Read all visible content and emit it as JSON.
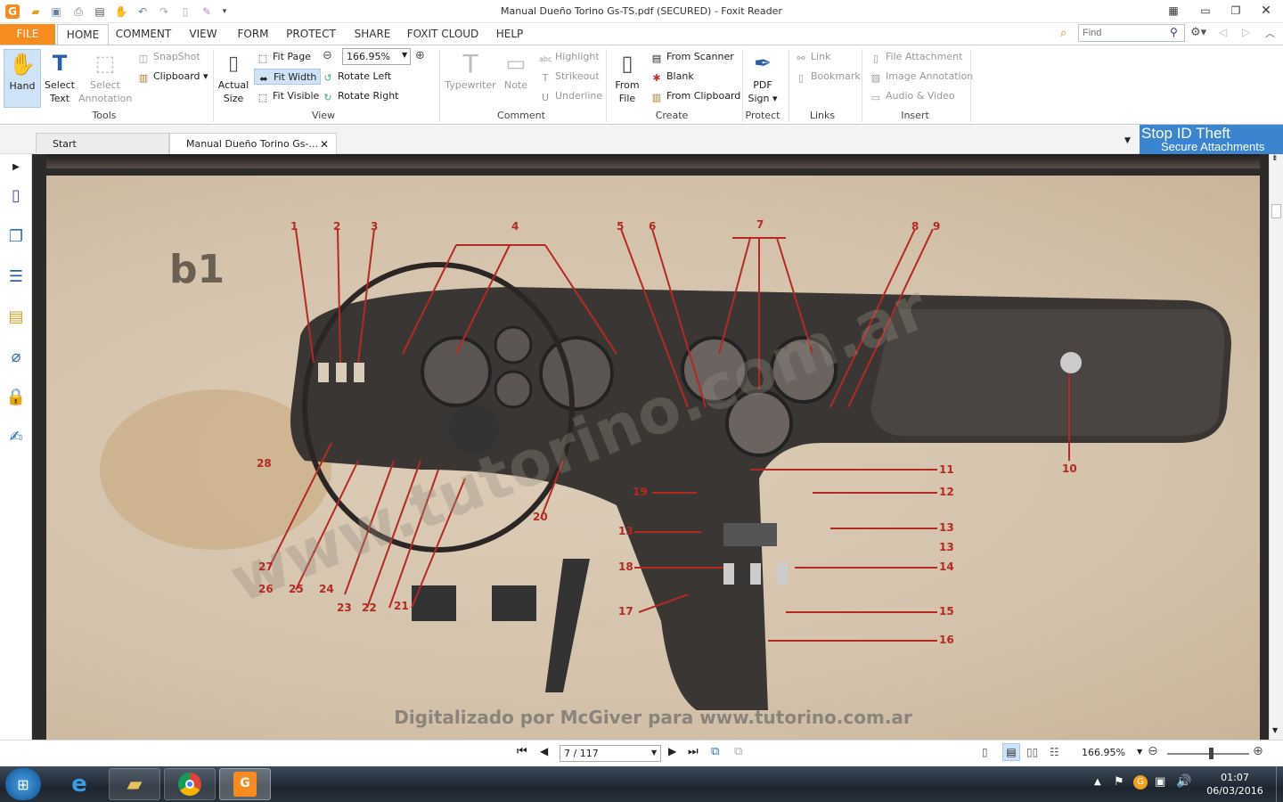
{
  "window": {
    "title": "Manual Dueño Torino Gs-TS.pdf (SECURED) - Foxit Reader"
  },
  "menu": {
    "file": "FILE",
    "tabs": [
      "HOME",
      "COMMENT",
      "VIEW",
      "FORM",
      "PROTECT",
      "SHARE",
      "FOXIT CLOUD",
      "HELP"
    ],
    "search_placeholder": "Find"
  },
  "ribbon": {
    "tools": {
      "hand": "Hand",
      "select_text_1": "Select",
      "select_text_2": "Text",
      "select_annotation_1": "Select",
      "select_annotation_2": "Annotation",
      "snapshot": "SnapShot",
      "clipboard": "Clipboard",
      "label": "Tools"
    },
    "view": {
      "actual_size_1": "Actual",
      "actual_size_2": "Size",
      "fit_page": "Fit Page",
      "fit_width": "Fit Width",
      "fit_visible": "Fit Visible",
      "zoom_value": "166.95%",
      "rotate_left": "Rotate Left",
      "rotate_right": "Rotate Right",
      "label": "View"
    },
    "comment": {
      "typewriter": "Typewriter",
      "note": "Note",
      "highlight": "Highlight",
      "strikeout": "Strikeout",
      "underline": "Underline",
      "label": "Comment"
    },
    "create": {
      "from_file_1": "From",
      "from_file_2": "File",
      "from_scanner": "From Scanner",
      "blank": "Blank",
      "from_clipboard": "From Clipboard",
      "label": "Create"
    },
    "protect": {
      "pdf_sign_1": "PDF",
      "pdf_sign_2": "Sign",
      "label": "Protect"
    },
    "links": {
      "link": "Link",
      "bookmark": "Bookmark",
      "label": "Links"
    },
    "insert": {
      "file_attachment": "File Attachment",
      "image_annotation": "Image Annotation",
      "audio_video": "Audio & Video",
      "label": "Insert"
    }
  },
  "doc_tabs": {
    "start": "Start",
    "current": "Manual Dueño Torino Gs-..."
  },
  "ad": {
    "line1": "Stop ID Theft",
    "line2": "Secure Attachments"
  },
  "page": {
    "figure_label": "b1",
    "watermark": "www.tutorino.com.ar",
    "caption": "Digitalizado por McGiver para www.tutorino.com.ar",
    "callouts_top": [
      "1",
      "2",
      "3",
      "4",
      "5",
      "6",
      "7",
      "8",
      "9"
    ],
    "callouts_right": [
      "11",
      "12",
      "13",
      "13",
      "14",
      "15",
      "16"
    ],
    "callouts_left": [
      "19",
      "13",
      "18",
      "17"
    ],
    "callouts_bottom": [
      "27",
      "26",
      "25",
      "24",
      "23",
      "22",
      "21",
      "20",
      "28"
    ],
    "callout_far_right": "10"
  },
  "status": {
    "page_indicator": "7 / 117",
    "zoom": "166.95%"
  },
  "clock": {
    "time": "01:07",
    "date": "06/03/2016"
  }
}
